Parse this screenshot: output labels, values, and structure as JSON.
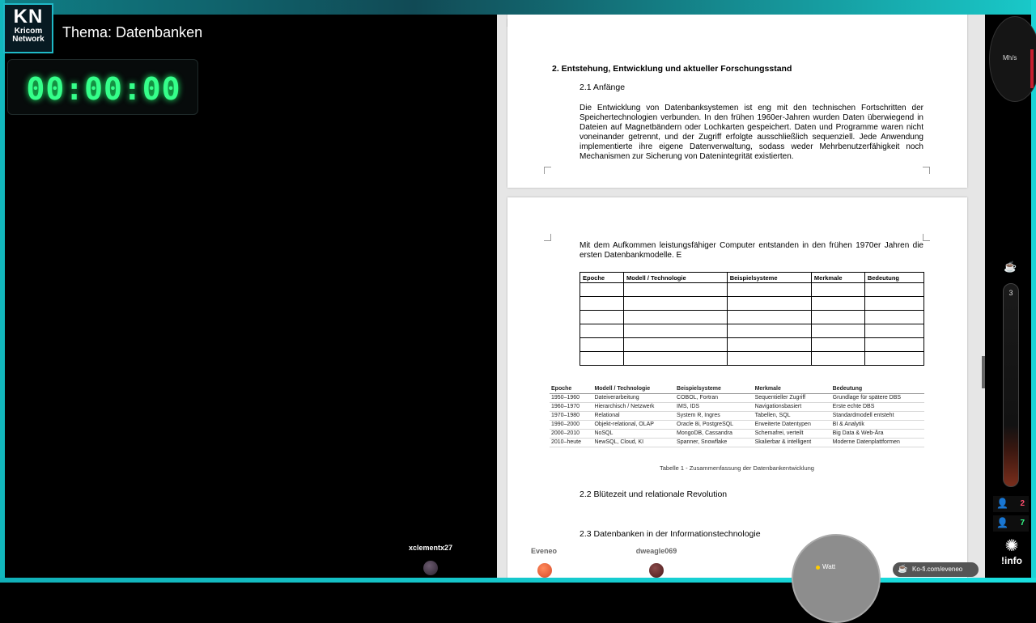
{
  "stream": {
    "logo_main": "KN",
    "logo_line1": "Kricom",
    "logo_line2": "Network",
    "theme": "Thema: Datenbanken",
    "timer": "00:00:00"
  },
  "document": {
    "heading2": "2. Entstehung, Entwicklung und aktueller Forschungsstand",
    "sec21": "2.1 Anfänge",
    "para1": "Die Entwicklung von Datenbanksystemen ist eng mit den technischen Fortschritten der Speichertechnologien verbunden. In den frühen 1960er-Jahren wurden Daten überwiegend in Dateien auf Magnetbändern oder Lochkarten gespeichert. Daten und Programme waren nicht voneinander getrennt, und der Zugriff erfolgte ausschließlich sequenziell. Jede Anwendung implementierte ihre eigene Datenverwaltung, sodass weder Mehrbenutzerfähigkeit noch Mechanismen zur Sicherung von Datenintegrität existierten.",
    "para2": "Mit dem Aufkommen leistungsfähiger Computer entstanden in den frühen 1970er Jahren die ersten Datenbankmodelle. E",
    "table_headers": [
      "Epoche",
      "Modell / Technologie",
      "Beispielsysteme",
      "Merkmale",
      "Bedeutung"
    ],
    "table_rows": [
      [
        "1950–1960",
        "Dateiverarbeitung",
        "COBOL, Fortran",
        "Sequentieller Zugriff",
        "Grundlage für spätere DBS"
      ],
      [
        "1960–1970",
        "Hierarchisch / Netzwerk",
        "IMS, IDS",
        "Navigationsbasiert",
        "Erste echte DBS"
      ],
      [
        "1970–1980",
        "Relational",
        "System R, Ingres",
        "Tabellen, SQL",
        "Standardmodell entsteht"
      ],
      [
        "1990–2000",
        "Objekt-relational, OLAP",
        "Oracle 8i, PostgreSQL",
        "Erweiterte Datentypen",
        "BI & Analytik"
      ],
      [
        "2000–2010",
        "NoSQL",
        "MongoDB, Cassandra",
        "Schemafrei, verteilt",
        "Big Data & Web-Ära"
      ],
      [
        "2010–heute",
        "NewSQL, Cloud, KI",
        "Spanner, Snowflake",
        "Skalierbar & intelligent",
        "Moderne Datenplattformen"
      ]
    ],
    "caption": "Tabelle 1 - Zusammenfassung der Datenbankentwicklung",
    "sec22": "2.2 Blütezeit und relationale Revolution",
    "sec23": "2.3 Datenbanken in der Informationstechnologie"
  },
  "overlay": {
    "gauge_label": "Mh/s",
    "tube_level": "3",
    "viewers_a": "2",
    "viewers_b": "7",
    "info": "!info",
    "username1": "xclementx27",
    "username2": "Eveneo",
    "username3": "dweagle069",
    "watt_label": "Watt",
    "kofi": "Ko-fi.com/eveneo",
    "colors": {
      "accent": "#1fb9c7",
      "timer": "#35ff8a",
      "viewer_a": "#ff4d6d",
      "viewer_b": "#35ff8a"
    }
  }
}
